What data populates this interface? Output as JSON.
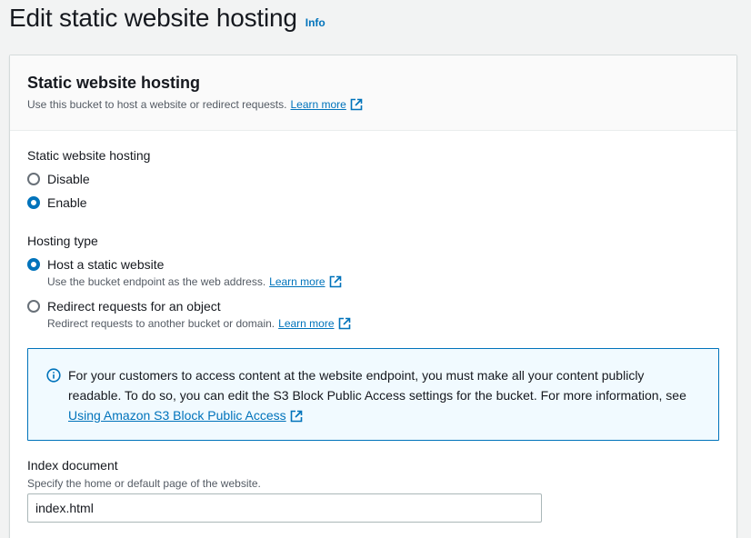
{
  "header": {
    "title": "Edit static website hosting",
    "info_label": "Info"
  },
  "panel": {
    "title": "Static website hosting",
    "description": "Use this bucket to host a website or redirect requests.",
    "learn_more": "Learn more"
  },
  "hosting": {
    "label": "Static website hosting",
    "options": [
      {
        "label": "Disable",
        "selected": false
      },
      {
        "label": "Enable",
        "selected": true
      }
    ]
  },
  "hosting_type": {
    "label": "Hosting type",
    "options": [
      {
        "label": "Host a static website",
        "description": "Use the bucket endpoint as the web address.",
        "learn_more": "Learn more",
        "selected": true
      },
      {
        "label": "Redirect requests for an object",
        "description": "Redirect requests to another bucket or domain.",
        "learn_more": "Learn more",
        "selected": false
      }
    ]
  },
  "alert": {
    "text": "For your customers to access content at the website endpoint, you must make all your content publicly readable. To do so, you can edit the S3 Block Public Access settings for the bucket. For more information, see",
    "link": "Using Amazon S3 Block Public Access"
  },
  "index_document": {
    "label": "Index document",
    "help": "Specify the home or default page of the website.",
    "value": "index.html"
  },
  "colors": {
    "link": "#0073bb",
    "background": "#f2f3f3",
    "alert_background": "#f1faff"
  }
}
